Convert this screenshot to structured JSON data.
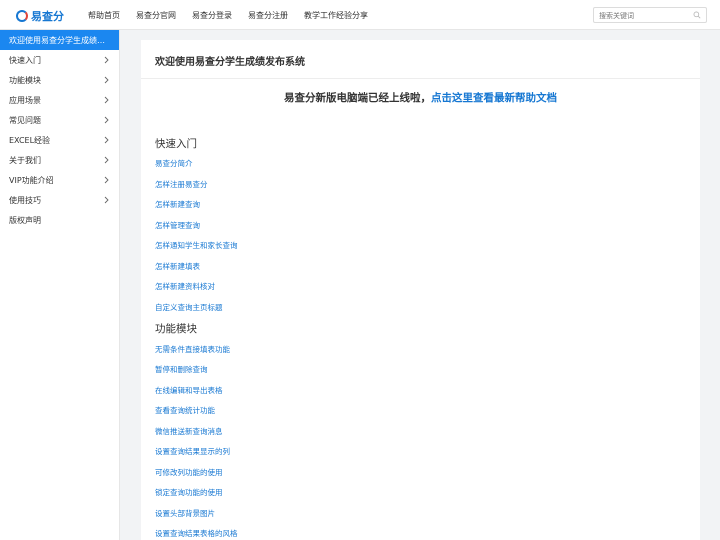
{
  "header": {
    "logo_text": "易查分",
    "nav": [
      "帮助首页",
      "易查分官网",
      "易查分登录",
      "易查分注册",
      "教学工作经验分享"
    ],
    "search_placeholder": "搜索关键词"
  },
  "sidebar": {
    "items": [
      {
        "label": "欢迎使用易查分学生成绩发布...",
        "active": true,
        "chevron": false
      },
      {
        "label": "快速入门",
        "chevron": true
      },
      {
        "label": "功能模块",
        "chevron": true
      },
      {
        "label": "应用场景",
        "chevron": true
      },
      {
        "label": "常见问题",
        "chevron": true
      },
      {
        "label": "EXCEL经验",
        "chevron": true
      },
      {
        "label": "关于我们",
        "chevron": true
      },
      {
        "label": "VIP功能介绍",
        "chevron": true
      },
      {
        "label": "使用技巧",
        "chevron": true
      },
      {
        "label": "版权声明",
        "chevron": false
      }
    ]
  },
  "main": {
    "title": "欢迎使用易查分学生成绩发布系统",
    "notice_text": "易查分新版电脑端已经上线啦，",
    "notice_link": "点击这里查看最新帮助文档",
    "sections": [
      {
        "title": "快速入门",
        "links": [
          "易查分简介",
          "怎样注册易查分",
          "怎样新建查询",
          "怎样管理查询",
          "怎样通知学生和家长查询",
          "怎样新建填表",
          "怎样新建资料核对",
          "自定义查询主页标题"
        ]
      },
      {
        "title": "功能模块",
        "links": [
          "无需条件直接填表功能",
          "暂停和删除查询",
          "在线编辑和导出表格",
          "查看查询统计功能",
          "微信推送新查询消息",
          "设置查询结果显示的列",
          "可修改列功能的使用",
          "锁定查询功能的使用",
          "设置头部背景图片",
          "设置查询结果表格的风格"
        ]
      }
    ]
  }
}
